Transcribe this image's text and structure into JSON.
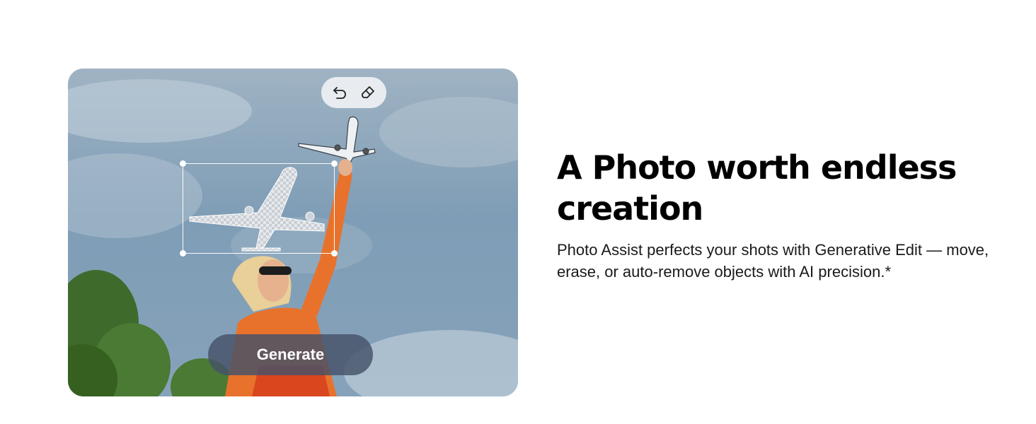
{
  "photo": {
    "toolbar": {
      "undo_icon": "undo-arrow-icon",
      "erase_icon": "eraser-icon"
    },
    "generate_label": "Generate"
  },
  "content": {
    "headline": "A Photo worth endless creation",
    "description": "Photo Assist perfects your shots with Generative Edit — move, erase, or auto-remove objects with AI precision.*"
  }
}
